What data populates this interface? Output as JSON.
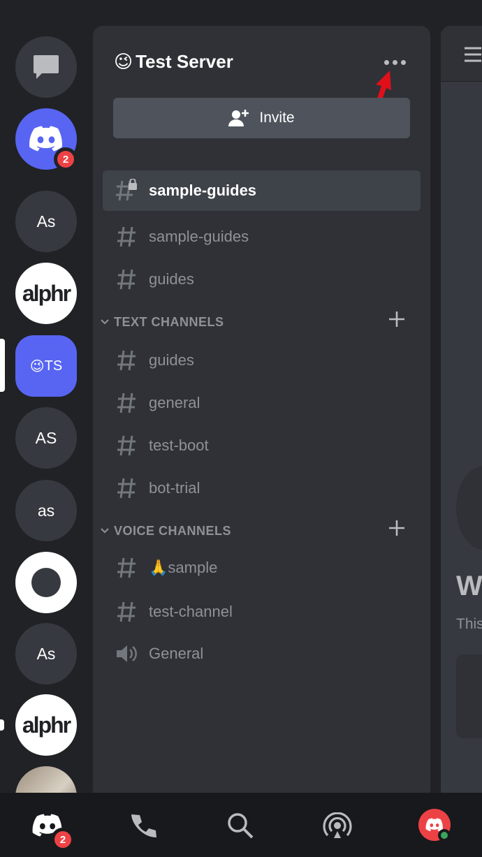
{
  "server": {
    "name": "Test Server",
    "emoji": "😉",
    "invite_label": "Invite"
  },
  "rail": {
    "items": [
      {
        "kind": "dm",
        "label": ""
      },
      {
        "kind": "home",
        "badge": "2"
      },
      {
        "kind": "text",
        "label": "As"
      },
      {
        "kind": "logo",
        "label": "alphr"
      },
      {
        "kind": "selected",
        "label": "TS",
        "emoji": "😉"
      },
      {
        "kind": "text",
        "label": "AS"
      },
      {
        "kind": "text",
        "label": "as"
      },
      {
        "kind": "ring",
        "label": ""
      },
      {
        "kind": "text",
        "label": "As"
      },
      {
        "kind": "logo",
        "label": "alphr"
      },
      {
        "kind": "photo",
        "label": ""
      }
    ]
  },
  "channels": {
    "top": [
      {
        "name": "sample-guides",
        "icon": "locked-hash-icon",
        "active": true
      },
      {
        "name": "sample-guides",
        "icon": "hash-icon",
        "active": false
      },
      {
        "name": "guides",
        "icon": "hash-icon",
        "active": false
      }
    ],
    "text_category": "TEXT CHANNELS",
    "text": [
      {
        "name": "guides"
      },
      {
        "name": "general"
      },
      {
        "name": "test-boot"
      },
      {
        "name": "bot-trial"
      }
    ],
    "voice_category": "VOICE CHANNELS",
    "voice": [
      {
        "name": "🙏sample",
        "icon": "hash-icon"
      },
      {
        "name": "test-channel",
        "icon": "hash-icon"
      },
      {
        "name": "General",
        "icon": "speaker-icon"
      }
    ]
  },
  "main": {
    "heading_partial": "W",
    "body_partial": "This"
  },
  "tabbar": {
    "home_badge": "2"
  },
  "colors": {
    "blurple": "#5865f2",
    "danger": "#ed4245",
    "online": "#3ba55d",
    "annotation_arrow": "#e0101a"
  }
}
